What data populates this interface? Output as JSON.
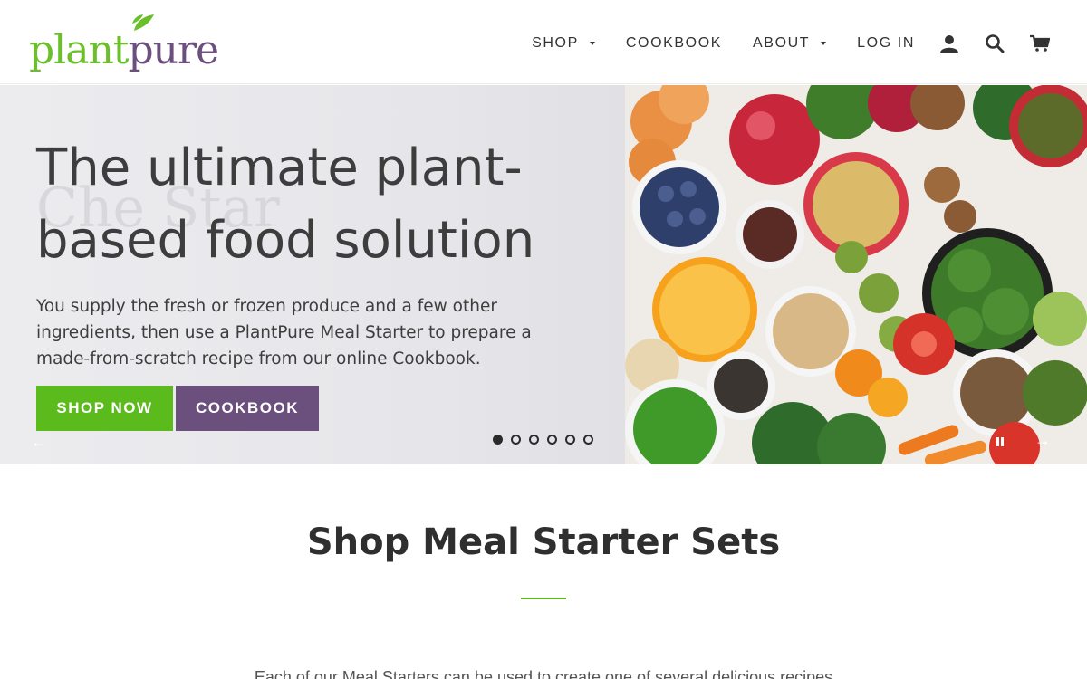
{
  "brand": {
    "logo_left": "plant",
    "logo_right": "pure",
    "green": "#6bbf2a",
    "purple": "#6b4f7c"
  },
  "nav": {
    "items": [
      {
        "label": "SHOP",
        "dropdown": true
      },
      {
        "label": "COOKBOOK",
        "dropdown": false
      },
      {
        "label": "ABOUT",
        "dropdown": true
      },
      {
        "label": "LOG IN",
        "dropdown": false
      }
    ],
    "icons": [
      "account-icon",
      "search-icon",
      "cart-icon"
    ]
  },
  "hero": {
    "ghost_text": "Che Star",
    "title": "The ultimate plant-based food solution",
    "subtitle": "You supply the fresh or frozen produce and a few other ingredients, then use a PlantPure Meal Starter to prepare a made-from-scratch recipe from our online Cookbook.",
    "shop_button": "SHOP NOW",
    "cookbook_button": "COOKBOOK",
    "slide_count": 6,
    "active_slide": 1,
    "arrow_left": "←",
    "arrow_right": "→"
  },
  "section": {
    "title": "Shop Meal Starter Sets",
    "body": "Each of our Meal Starters can be used to create one of several delicious recipes"
  }
}
